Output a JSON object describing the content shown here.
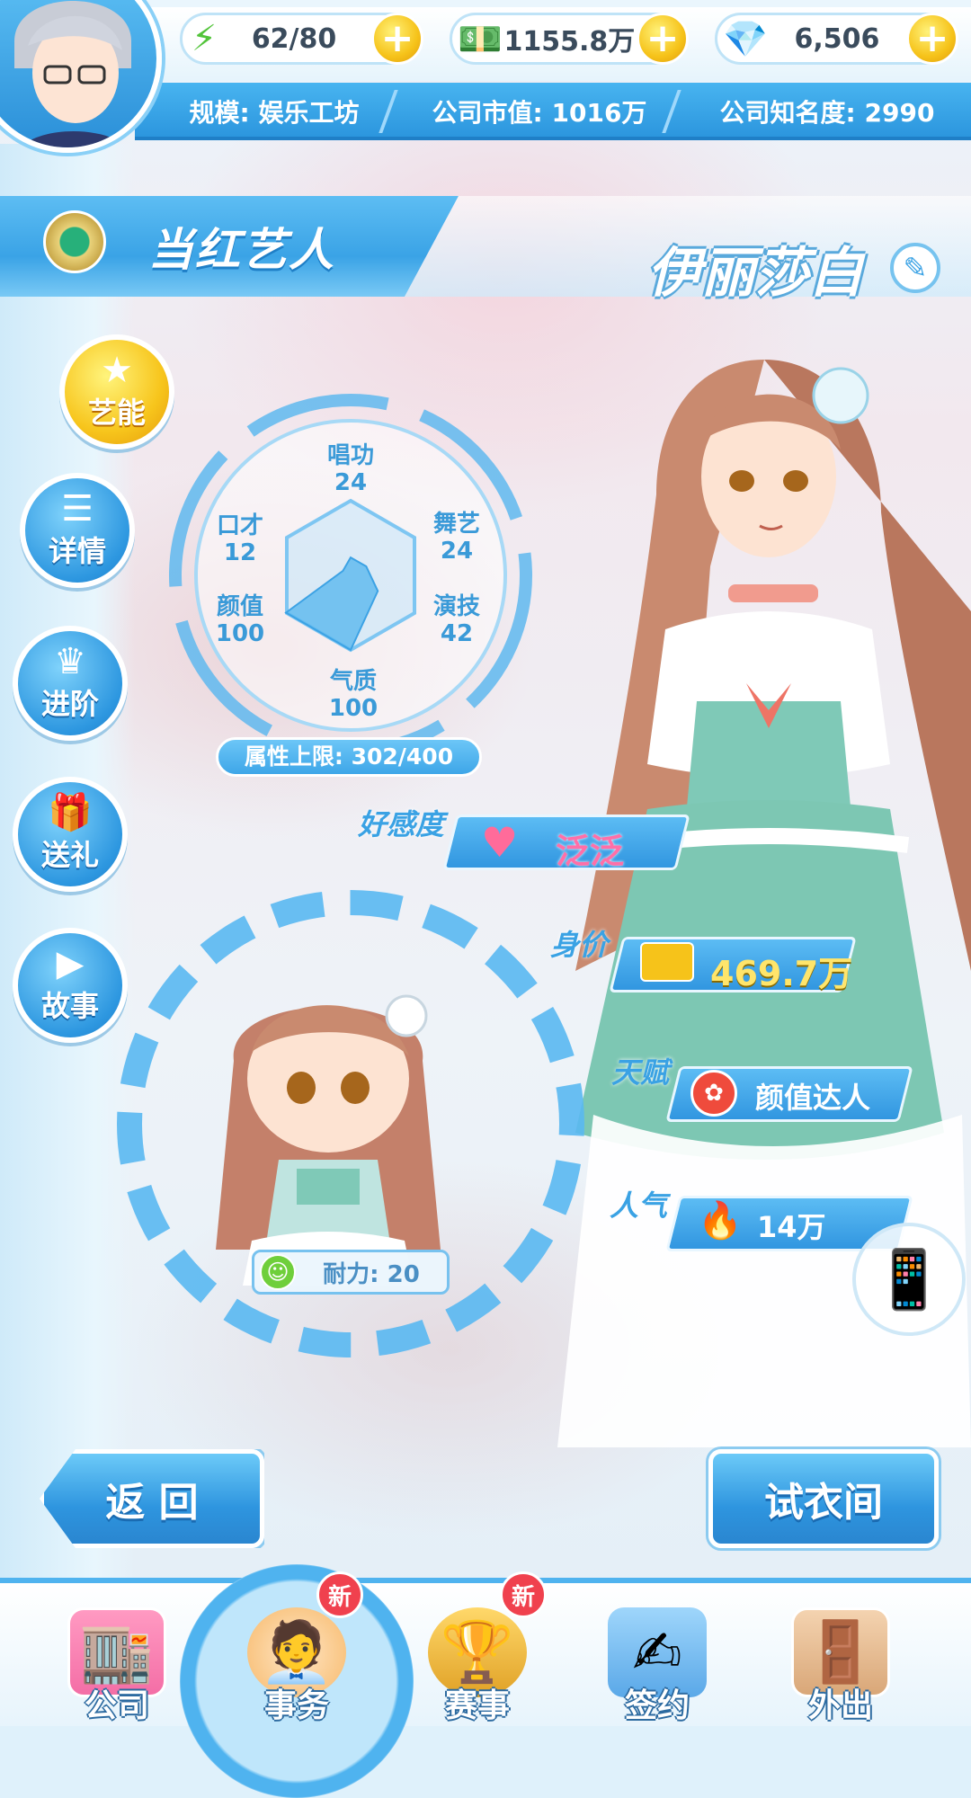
{
  "resources": {
    "energy": "62/80",
    "money": "1155.8万",
    "gems": "6,506"
  },
  "company": {
    "scale": "规模: 娱乐工坊",
    "value": "公司市值: 1016万",
    "fame": "公司知名度: 2990"
  },
  "header": {
    "title": "当红艺人",
    "artist_name": "伊丽莎白"
  },
  "side_menu": [
    {
      "label": "艺能",
      "icon": "star-icon",
      "active": true
    },
    {
      "label": "详情",
      "icon": "list-icon"
    },
    {
      "label": "进阶",
      "icon": "crown-icon"
    },
    {
      "label": "送礼",
      "icon": "gift-icon"
    },
    {
      "label": "故事",
      "icon": "play-icon"
    }
  ],
  "attributes": {
    "sing": {
      "label": "唱功",
      "value": "24"
    },
    "dance": {
      "label": "舞艺",
      "value": "24"
    },
    "acting": {
      "label": "演技",
      "value": "42"
    },
    "temperament": {
      "label": "气质",
      "value": "100"
    },
    "looks": {
      "label": "颜值",
      "value": "100"
    },
    "eloquence": {
      "label": "口才",
      "value": "12"
    },
    "limit": "属性上限: 302/400"
  },
  "radar_values": {
    "sing": 24,
    "dance": 24,
    "acting": 42,
    "temperament": 100,
    "looks": 100,
    "eloquence": 12,
    "max": 100
  },
  "info": {
    "favor_label": "好感度",
    "favor_value": "泛泛",
    "worth_label": "身价",
    "worth_value": "469.7万",
    "talent_label": "天赋",
    "talent_value": "颜值达人",
    "popularity_label": "人气",
    "popularity_value": "14万"
  },
  "stamina": "耐力: 20",
  "buttons": {
    "back": "返 回",
    "wardrobe": "试衣间"
  },
  "tabs": [
    {
      "label": "公司",
      "icon": "building-icon",
      "badge": ""
    },
    {
      "label": "事务",
      "icon": "manager-icon",
      "badge": "新"
    },
    {
      "label": "赛事",
      "icon": "trophy-icon",
      "badge": "新"
    },
    {
      "label": "签约",
      "icon": "contract-icon",
      "badge": ""
    },
    {
      "label": "外出",
      "icon": "door-icon",
      "badge": ""
    }
  ],
  "colors": {
    "primary": "#3aa3e6",
    "gold": "#f6c31a",
    "badge": "#f0414e"
  }
}
